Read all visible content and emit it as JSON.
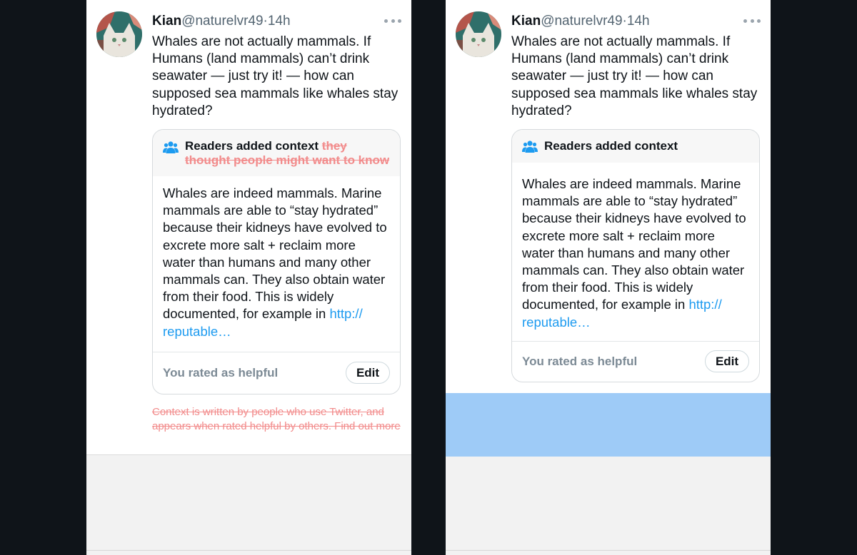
{
  "tweet": {
    "name": "Kian",
    "handle": "@naturelvr49",
    "separator": "·",
    "time": "14h",
    "text": "Whales are not actually mammals. If Humans (land mammals) can’t drink seawater — just try it! — how can supposed sea mammals like whales stay hydrated?"
  },
  "note": {
    "title": "Readers added context",
    "title_struck": "they thought people might want to know",
    "body": "Whales are indeed mammals. Marine mammals are able to “stay hydrated” because their kidneys have evolved to excrete more salt + reclaim more water than humans and many other mammals can. They also obtain water from their food. This is widely documented, for example in ",
    "link": "http:// reputable…",
    "rated_label": "You rated as helpful",
    "edit_label": "Edit"
  },
  "disclaimer": "Context is written by people who use Twitter, and appears when rated helpful by others. Find out more",
  "colors": {
    "background": "#0f1419",
    "strike": "#f28b8b",
    "link": "#1d9bf0",
    "highlight_band": "#9ecbf7"
  },
  "icons": [
    "more-icon",
    "people-icon",
    "avatar-cat"
  ]
}
